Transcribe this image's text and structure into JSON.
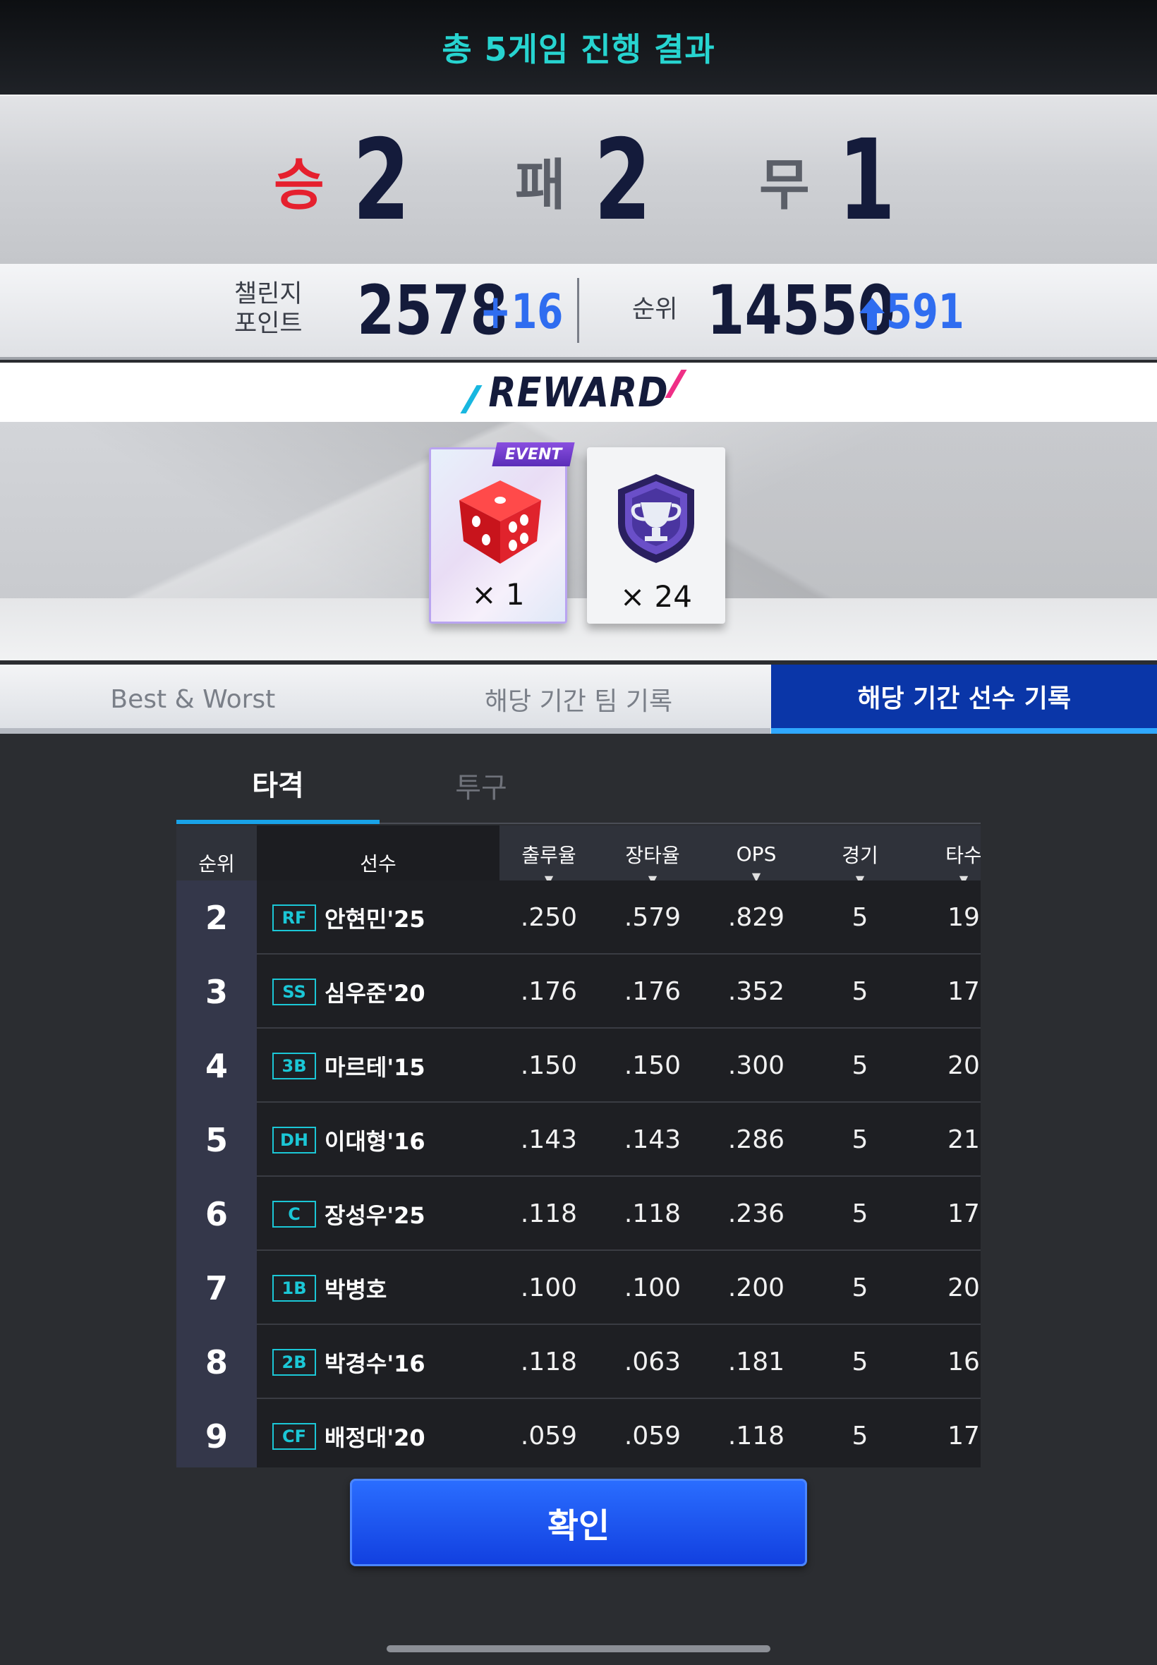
{
  "header": {
    "title": "총 5게임 진행 결과"
  },
  "record": {
    "win_label": "승",
    "win_count": "2",
    "loss_label": "패",
    "loss_count": "2",
    "draw_label": "무",
    "draw_count": "1",
    "colors": {
      "win": "#e5202e",
      "neutral": "#5b5f68",
      "number": "#141b3b"
    }
  },
  "stats": {
    "points_label_line1": "챌린지",
    "points_label_line2": "포인트",
    "points_value": "2578",
    "points_delta": "+16",
    "rank_label": "순위",
    "rank_value": "14550",
    "rank_delta": "591",
    "rank_delta_icon": "arrow-up-icon"
  },
  "reward": {
    "title": "REWARD",
    "items": [
      {
        "icon": "dice-icon",
        "tag": "EVENT",
        "count": "× 1"
      },
      {
        "icon": "trophy-emblem-icon",
        "count": "× 24"
      }
    ]
  },
  "tabs": [
    {
      "label": "Best & Worst",
      "active": false
    },
    {
      "label": "해당 기간 팀 기록",
      "active": false
    },
    {
      "label": "해당 기간 선수 기록",
      "active": true
    }
  ],
  "sub_tabs": [
    {
      "label": "타격",
      "active": true
    },
    {
      "label": "투구",
      "active": false
    }
  ],
  "table": {
    "columns": [
      "순위",
      "선수",
      "출루율",
      "장타율",
      "OPS",
      "경기",
      "타수"
    ],
    "rows": [
      {
        "rank": "2",
        "pos": "RF",
        "name": "안현민'25",
        "obp": ".250",
        "slg": ".579",
        "ops": ".829",
        "g": "5",
        "ab": "19"
      },
      {
        "rank": "3",
        "pos": "SS",
        "name": "심우준'20",
        "obp": ".176",
        "slg": ".176",
        "ops": ".352",
        "g": "5",
        "ab": "17"
      },
      {
        "rank": "4",
        "pos": "3B",
        "name": "마르테'15",
        "obp": ".150",
        "slg": ".150",
        "ops": ".300",
        "g": "5",
        "ab": "20"
      },
      {
        "rank": "5",
        "pos": "DH",
        "name": "이대형'16",
        "obp": ".143",
        "slg": ".143",
        "ops": ".286",
        "g": "5",
        "ab": "21"
      },
      {
        "rank": "6",
        "pos": "C",
        "name": "장성우'25",
        "obp": ".118",
        "slg": ".118",
        "ops": ".236",
        "g": "5",
        "ab": "17"
      },
      {
        "rank": "7",
        "pos": "1B",
        "name": "박병호",
        "obp": ".100",
        "slg": ".100",
        "ops": ".200",
        "g": "5",
        "ab": "20"
      },
      {
        "rank": "8",
        "pos": "2B",
        "name": "박경수'16",
        "obp": ".118",
        "slg": ".063",
        "ops": ".181",
        "g": "5",
        "ab": "16"
      },
      {
        "rank": "9",
        "pos": "CF",
        "name": "배정대'20",
        "obp": ".059",
        "slg": ".059",
        "ops": ".118",
        "g": "5",
        "ab": "17"
      }
    ]
  },
  "confirm_button": {
    "label": "확인"
  }
}
